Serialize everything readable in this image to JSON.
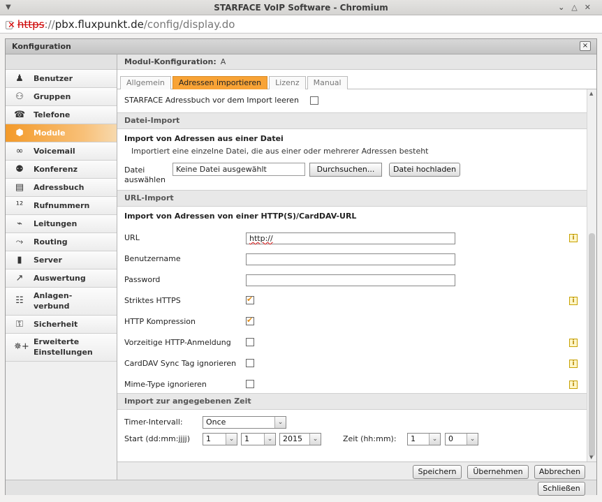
{
  "browser": {
    "title": "STARFACE VoIP Software - Chromium",
    "url_scheme": "https",
    "url_sep": "://",
    "url_host": "pbx.fluxpunkt.de",
    "url_path": "/config/display.do"
  },
  "window": {
    "title": "Konfiguration",
    "close_label": "×",
    "close_button": "Schließen"
  },
  "sidebar": {
    "items": [
      {
        "label": "Benutzer",
        "icon": "user-icon",
        "glyph": "♟"
      },
      {
        "label": "Gruppen",
        "icon": "group-icon",
        "glyph": "⚇"
      },
      {
        "label": "Telefone",
        "icon": "phone-icon",
        "glyph": "☎"
      },
      {
        "label": "Module",
        "icon": "cube-icon",
        "glyph": "⬢",
        "active": true
      },
      {
        "label": "Voicemail",
        "icon": "voicemail-icon",
        "glyph": "∞"
      },
      {
        "label": "Konferenz",
        "icon": "conference-icon",
        "glyph": "⚉"
      },
      {
        "label": "Adressbuch",
        "icon": "addressbook-icon",
        "glyph": "▤"
      },
      {
        "label": "Rufnummern",
        "icon": "numbers-icon",
        "glyph": "¹²"
      },
      {
        "label": "Leitungen",
        "icon": "plug-icon",
        "glyph": "⌁"
      },
      {
        "label": "Routing",
        "icon": "routing-icon",
        "glyph": "⤳"
      },
      {
        "label": "Server",
        "icon": "server-icon",
        "glyph": "▮"
      },
      {
        "label": "Auswertung",
        "icon": "chart-icon",
        "glyph": "↗"
      },
      {
        "label": "Anlagen-\nverbund",
        "icon": "network-icon",
        "glyph": "☷"
      },
      {
        "label": "Sicherheit",
        "icon": "lock-icon",
        "glyph": "⚿"
      },
      {
        "label": "Erweiterte\nEinstellungen",
        "icon": "settings-icon",
        "glyph": "✵+"
      }
    ]
  },
  "module": {
    "header_label": "Modul-Konfiguration:",
    "header_value": "A",
    "tabs": [
      "Allgemein",
      "Adressen importieren",
      "Lizenz",
      "Manual"
    ],
    "active_tab": 1
  },
  "form": {
    "clear_label": "STARFACE Adressbuch vor dem Import leeren",
    "clear_checked": false,
    "file_section": "Datei-Import",
    "file_header": "Import von Adressen aus einer Datei",
    "file_desc": "Importiert eine einzelne Datei, die aus einer oder mehrerer Adressen besteht",
    "file_label_1": "Datei",
    "file_label_2": "auswählen",
    "file_value": "Keine Datei ausgewählt",
    "browse_button": "Durchsuchen...",
    "upload_button": "Datei hochladen",
    "url_section": "URL-Import",
    "url_header": "Import von Adressen von einer HTTP(S)/CardDAV-URL",
    "url_label": "URL",
    "url_value": "http://",
    "username_label": "Benutzername",
    "username_value": "",
    "password_label": "Password",
    "password_value": "",
    "strict_https_label": "Striktes HTTPS",
    "strict_https_checked": true,
    "compression_label": "HTTP Kompression",
    "compression_checked": true,
    "preemptive_label": "Vorzeitige HTTP-Anmeldung",
    "preemptive_checked": false,
    "carddav_label": "CardDAV Sync Tag ignorieren",
    "carddav_checked": false,
    "mime_label": "Mime-Type ignorieren",
    "mime_checked": false,
    "info_glyph": "i",
    "time_section": "Import zur angegebenen Zeit",
    "interval_label": "Timer-Intervall:",
    "interval_value": "Once",
    "start_label": "Start (dd:mm:jjjj)",
    "start_day": "1",
    "start_month": "1",
    "start_year": "2015",
    "time_label": "Zeit (hh:mm):",
    "time_hour": "1",
    "time_minute": "0",
    "arrow_glyph": "⌄"
  },
  "footer": {
    "save": "Speichern",
    "apply": "Übernehmen",
    "cancel": "Abbrechen"
  }
}
